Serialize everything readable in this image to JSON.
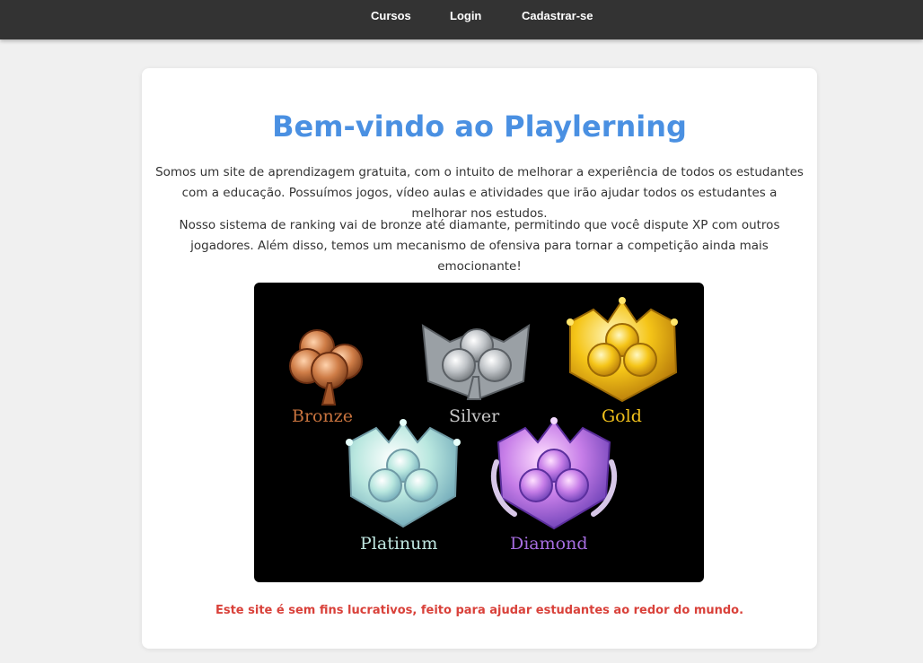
{
  "nav": {
    "items": [
      "Cursos",
      "Login",
      "Cadastrar-se"
    ]
  },
  "main": {
    "title": "Bem-vindo ao Playlerning",
    "paragraph1": "Somos um site de aprendizagem gratuita, com o intuito de melhorar a experiência de todos os estudantes com a educação. Possuímos jogos, vídeo aulas e atividades que irão ajudar todos os estudantes a melhorar nos estudos.",
    "paragraph2": "Nosso sistema de ranking vai de bronze até diamante, permitindo que você dispute XP com outros jogadores. Além disso, temos um mecanismo de ofensiva para tornar a competição ainda mais emocionante!",
    "ranks": [
      "Bronze",
      "Silver",
      "Gold",
      "Platinum",
      "Diamond"
    ],
    "footer_note": "Este site é sem fins lucrativos, feito para ajudar estudantes ao redor do mundo."
  },
  "colors": {
    "nav_bg": "#333333",
    "title": "#4a90e2",
    "note": "#d9413a",
    "bronze": "#c8733e",
    "silver": "#c8c8c8",
    "gold": "#f2c21c",
    "platinum": "#bfe6e0",
    "diamond": "#a66de0"
  }
}
